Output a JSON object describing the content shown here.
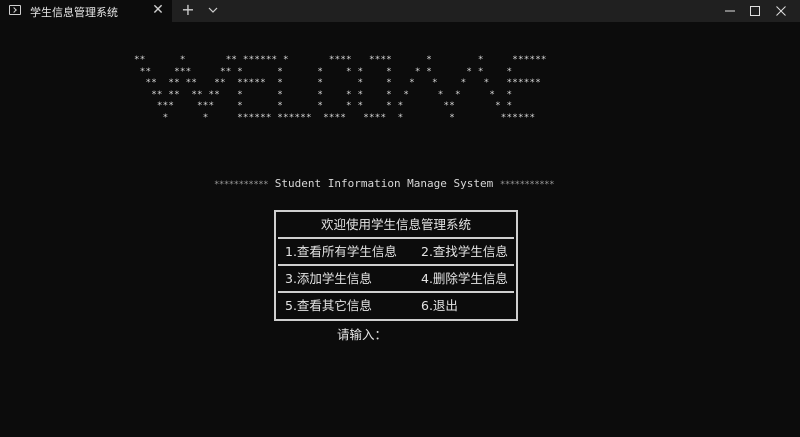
{
  "tab": {
    "title": "学生信息管理系统",
    "close_glyph": "✕",
    "new_tab_glyph": "+"
  },
  "console": {
    "banner": "**      *       ** ****** *       ****   ****      *        *     ******\n **    ***     ** *      *      *    * *    *    * *      * *    *\n  **  ** **   **  *****  *      *      *    *   *   *    *   *   ******\n   ** **  ** **   *      *      *    * *    *  *     *  *     *  *\n    ***    ***    *      *      *    * *    * *       **       * *\n     *      *     ****** ******  ****   ****  *        *        ******",
    "subtitle_stars_left": "***********",
    "subtitle_text": " Student Information Manage System ",
    "subtitle_stars_right": "***********",
    "menu": {
      "title": "欢迎使用学生信息管理系统",
      "items": [
        "1.查看所有学生信息",
        "2.查找学生信息",
        "3.添加学生信息",
        "4.删除学生信息",
        "5.查看其它信息",
        "6.退出"
      ]
    },
    "prompt": "请输入："
  }
}
